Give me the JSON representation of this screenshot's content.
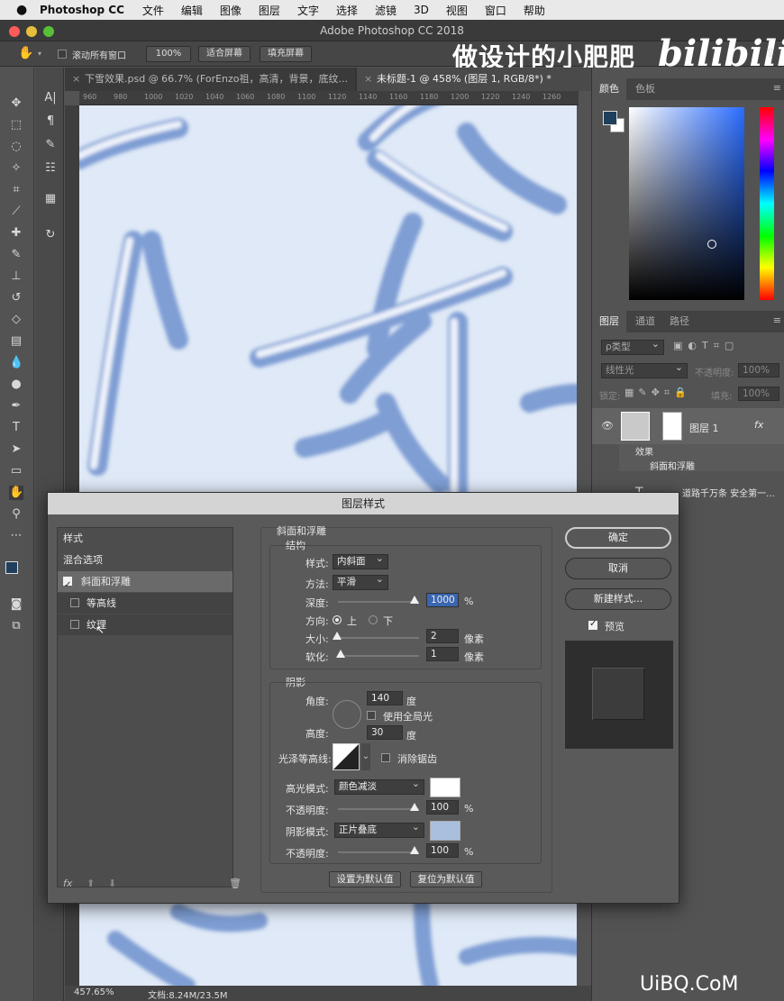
{
  "menubar": {
    "app": "Photoshop CC",
    "items": [
      "文件",
      "编辑",
      "图像",
      "图层",
      "文字",
      "选择",
      "滤镜",
      "3D",
      "视图",
      "窗口",
      "帮助"
    ]
  },
  "window": {
    "title": "Adobe Photoshop CC 2018"
  },
  "options": {
    "scroll_all": "滚动所有窗口",
    "zoom": "100%",
    "fit": "适合屏幕",
    "fill": "填充屏幕"
  },
  "overlay": {
    "uploader": "做设计的小肥肥",
    "platform": "bilibili"
  },
  "tabs": [
    {
      "label": "下雪效果.psd @ 66.7% (ForEnzo祖，高清，背景，底纹...",
      "active": false
    },
    {
      "label": "未标题-1 @ 458% (图层 1, RGB/8*) *",
      "active": true
    }
  ],
  "ruler": {
    "marks": [
      "960",
      "980",
      "1000",
      "1020",
      "1040",
      "1060",
      "1080",
      "1100",
      "1120",
      "1140",
      "1160",
      "1180",
      "1200",
      "1220",
      "1240",
      "1260"
    ]
  },
  "status": {
    "zoom": "457.65%",
    "doc": "文档:8.24M/23.5M"
  },
  "color_panel": {
    "tabs": [
      "颜色",
      "色板"
    ],
    "fg": "#1f3f5c"
  },
  "layers_panel": {
    "tabs": [
      "图层",
      "通道",
      "路径"
    ],
    "filter": "ρ类型",
    "blend": "线性光",
    "opacity_label": "不透明度:",
    "opacity": "100%",
    "lock": "锁定:",
    "fill_label": "填充:",
    "fill": "100%",
    "layers": [
      {
        "name": "图层 1",
        "fx": "fx",
        "effects_label": "效果",
        "effect": "斜面和浮雕"
      },
      {
        "name": "道路千万条 安全第一...",
        "fx": "fx"
      },
      {
        "name": "道路千万条 安全第一...",
        "fx": "fx"
      }
    ]
  },
  "dialog": {
    "title": "图层样式",
    "list": {
      "header": "样式",
      "blend": "混合选项",
      "items": [
        {
          "label": "斜面和浮雕",
          "checked": true
        },
        {
          "label": "等高线",
          "checked": false
        },
        {
          "label": "纹理",
          "checked": false
        }
      ]
    },
    "bevel": {
      "section": "斜面和浮雕",
      "structure": "结构",
      "style_label": "样式:",
      "style": "内斜面",
      "technique_label": "方法:",
      "technique": "平滑",
      "depth_label": "深度:",
      "depth": "1000",
      "pct": "%",
      "direction_label": "方向:",
      "up": "上",
      "down": "下",
      "size_label": "大小:",
      "size": "2",
      "soften_label": "软化:",
      "soften": "1",
      "px": "像素"
    },
    "shading": {
      "section": "阴影",
      "angle_label": "角度:",
      "angle": "140",
      "deg": "度",
      "global": "使用全局光",
      "altitude_label": "高度:",
      "altitude": "30",
      "gloss_label": "光泽等高线:",
      "antialias": "消除锯齿",
      "hl_mode_label": "高光模式:",
      "hl_mode": "颜色减淡",
      "hl_color": "#ffffff",
      "hl_opacity_label": "不透明度:",
      "hl_opacity": "100",
      "sh_mode_label": "阴影模式:",
      "sh_mode": "正片叠底",
      "sh_color": "#a8c0de",
      "sh_opacity_label": "不透明度:",
      "sh_opacity": "100",
      "pct": "%"
    },
    "defaults": {
      "set": "设置为默认值",
      "reset": "复位为默认值"
    },
    "buttons": {
      "ok": "确定",
      "cancel": "取消",
      "new_style": "新建样式...",
      "preview": "预览"
    }
  },
  "site_watermark": "UiBQ.CoM"
}
